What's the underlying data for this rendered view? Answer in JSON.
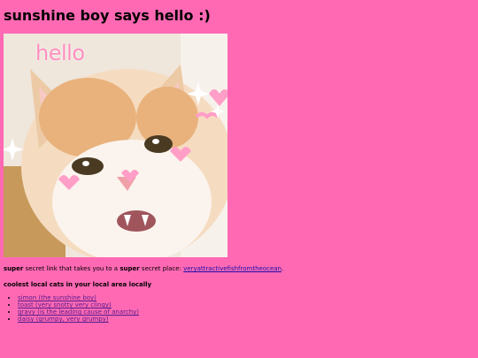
{
  "page": {
    "title": "sunshine boy says hello :)"
  },
  "image": {
    "overlay_text": "hello",
    "colors": {
      "fur": "#f3d2b0",
      "blush": "#ff9ec7",
      "sparkle": "#ffffff"
    }
  },
  "secret": {
    "bold1": "super",
    "text1": " secret link that takes you to a ",
    "bold2": "super",
    "text2": " secret place: ",
    "link_label": "veryattractivefishfromtheocean",
    "suffix": "."
  },
  "cats": {
    "heading": "coolest local cats in your local area locally",
    "items": [
      {
        "label": "simon (the sunshine boy)"
      },
      {
        "label": "toast (very snotty very clingy)"
      },
      {
        "label": "gravy (is the leading cause of anarchy)"
      },
      {
        "label": "daisy (grumpy, very grumpy)"
      }
    ]
  },
  "colors": {
    "background": "#ff69b4",
    "link": "#1a0dab"
  }
}
